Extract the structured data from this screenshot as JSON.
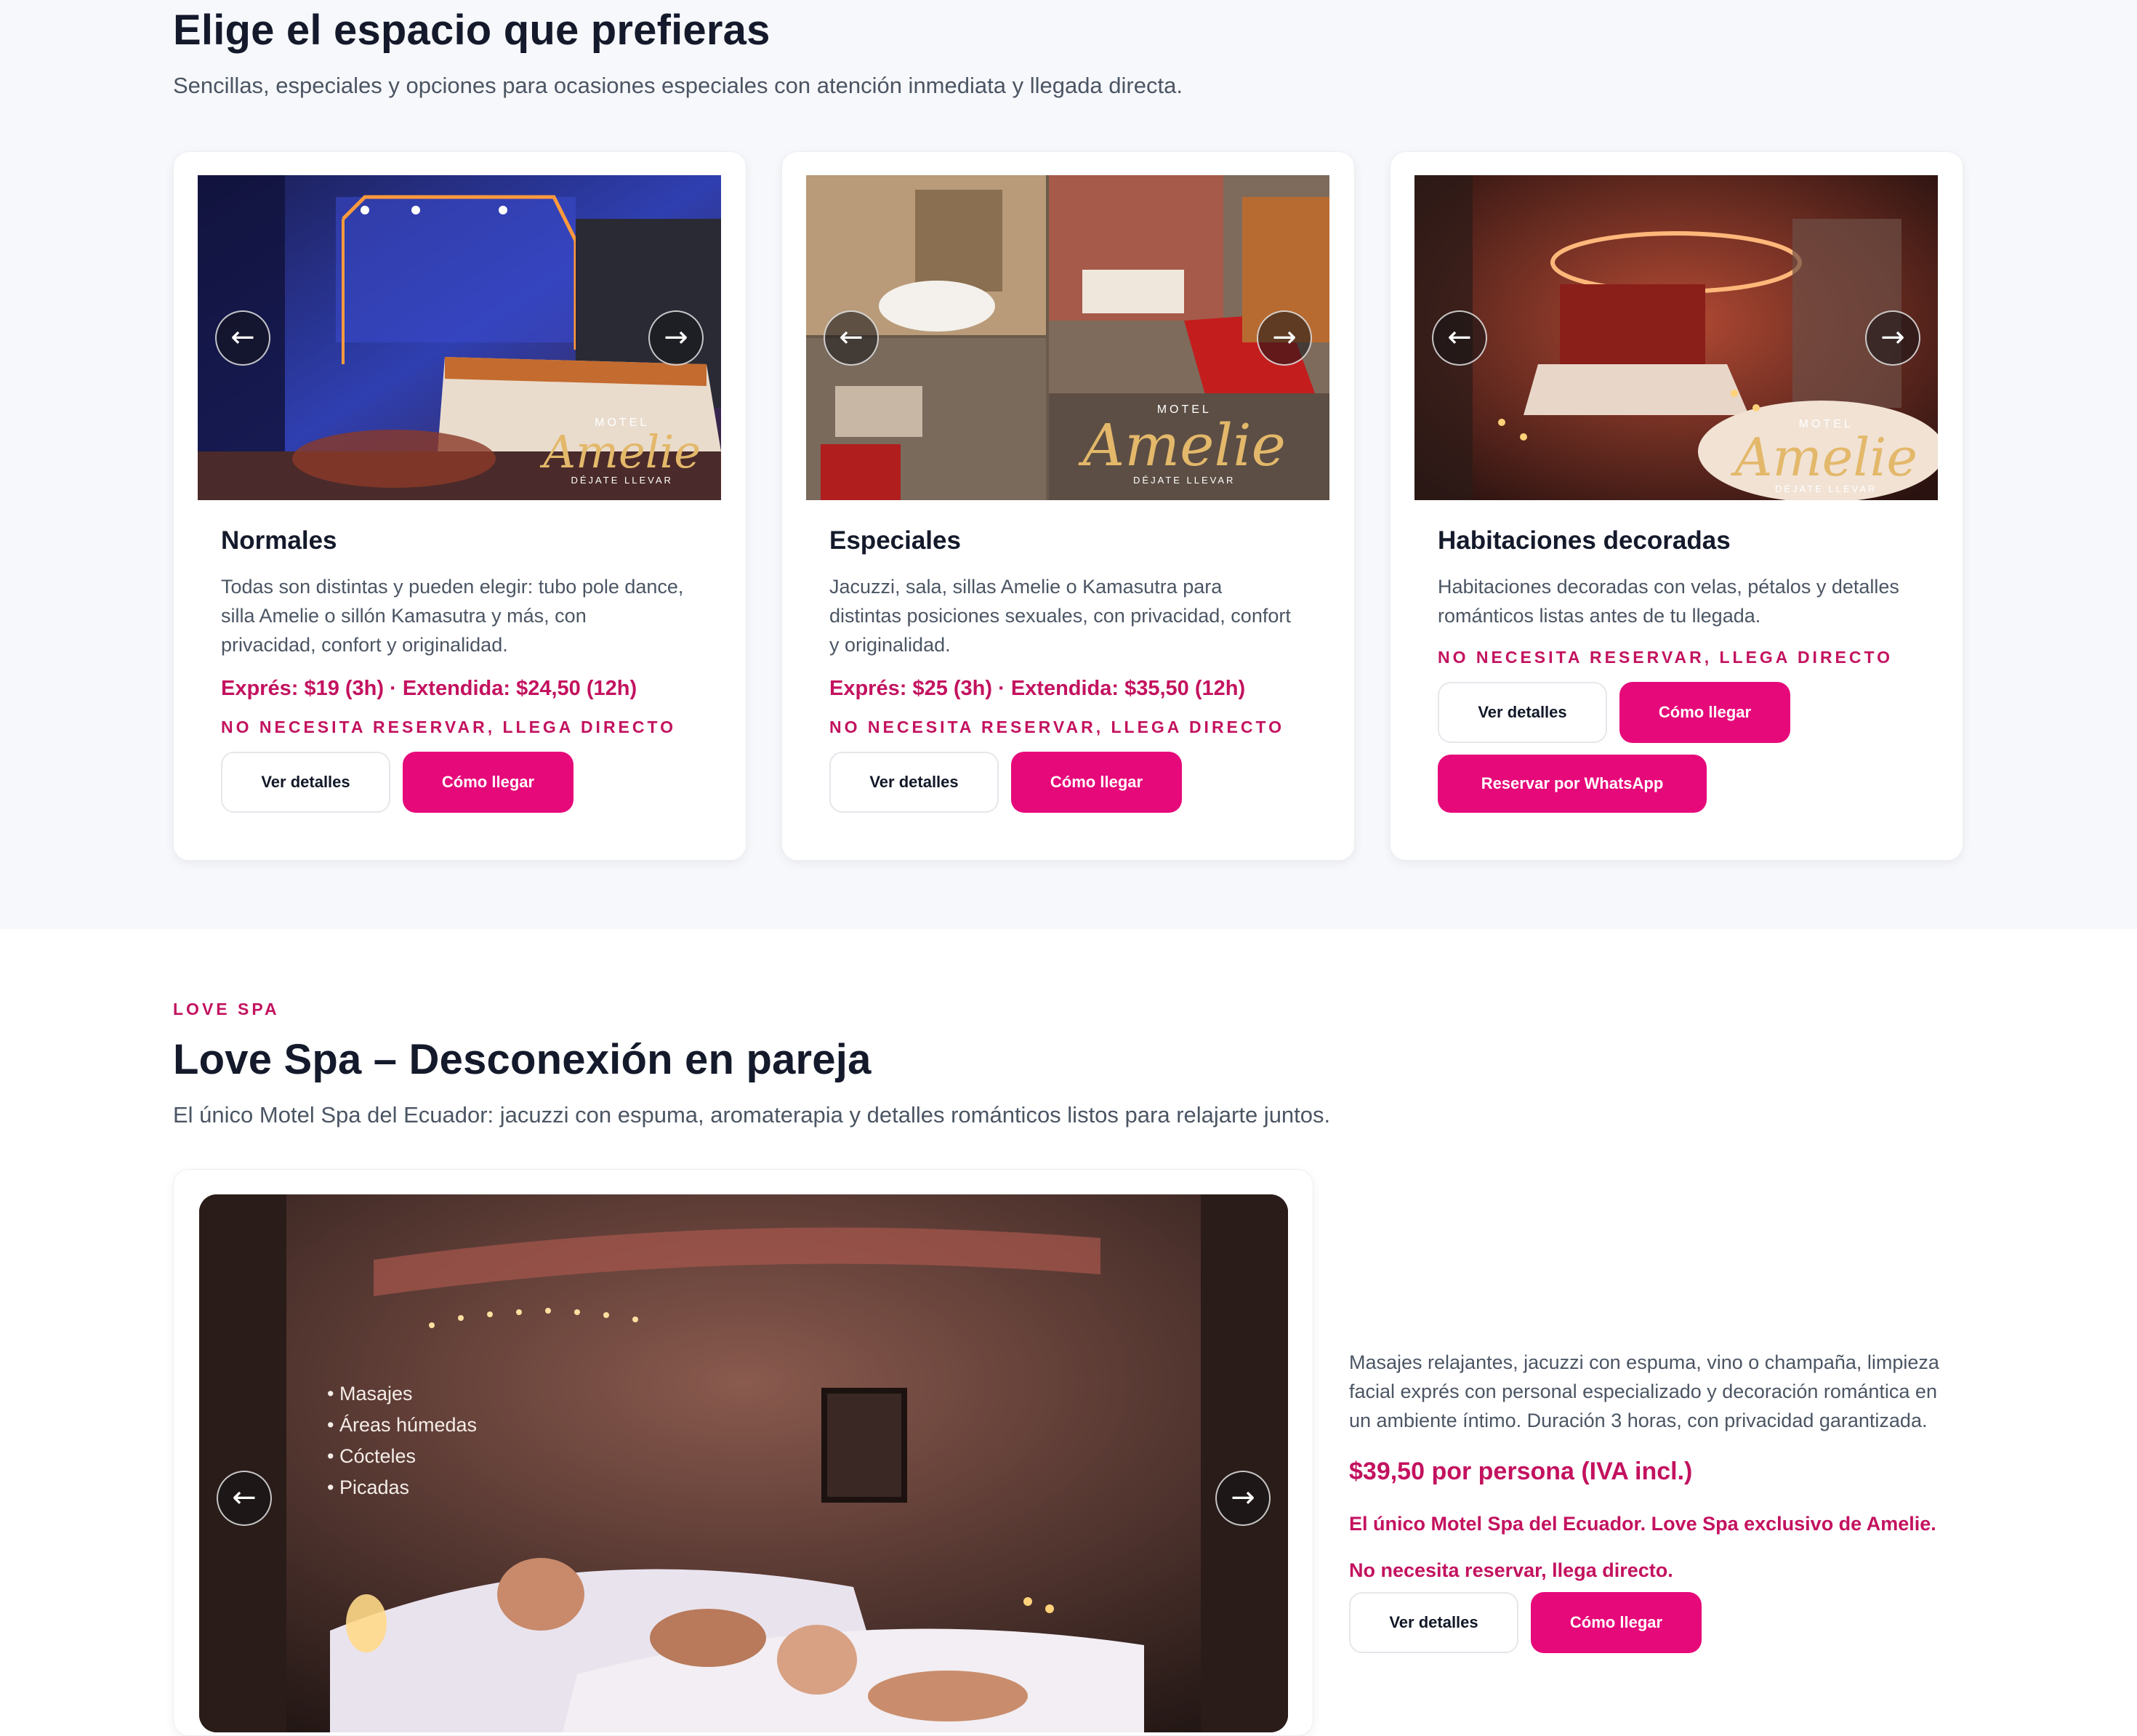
{
  "rooms_section": {
    "title": "Elige el espacio que prefieras",
    "subtitle": "Sencillas, especiales y opciones para ocasiones especiales con atención inmediata y llegada directa.",
    "cards": [
      {
        "title": "Normales",
        "description": "Todas son distintas y pueden elegir: tubo pole dance, silla Amelie o sillón Kamasutra y más, con privacidad, confort y originalidad.",
        "price": "Exprés: $19 (3h) · Extendida: $24,50 (12h)",
        "notice": "NO NECESITA RESERVAR, LLEGA DIRECTO",
        "details_label": "Ver detalles",
        "directions_label": "Cómo llegar"
      },
      {
        "title": "Especiales",
        "description": "Jacuzzi, sala, sillas Amelie o Kamasutra para distintas posiciones sexuales, con privacidad, confort y originalidad.",
        "price": "Exprés: $25 (3h) · Extendida: $35,50 (12h)",
        "notice": "NO NECESITA RESERVAR, LLEGA DIRECTO",
        "details_label": "Ver detalles",
        "directions_label": "Cómo llegar"
      },
      {
        "title": "Habitaciones decoradas",
        "description": "Habitaciones decoradas con velas, pétalos y detalles románticos listas antes de tu llegada.",
        "notice": "NO NECESITA RESERVAR, LLEGA DIRECTO",
        "details_label": "Ver detalles",
        "directions_label": "Cómo llegar",
        "whatsapp_label": "Reservar por WhatsApp"
      }
    ],
    "logo": {
      "top": "MOTEL",
      "name": "Amelie",
      "tagline": "DÉJATE LLEVAR"
    }
  },
  "spa_section": {
    "eyebrow": "LOVE SPA",
    "title": "Love Spa – Desconexión en pareja",
    "subtitle": "El único Motel Spa del Ecuador: jacuzzi con espuma, aromaterapia y detalles románticos listos para relajarte juntos.",
    "image_bullets": [
      "• Masajes",
      "• Áreas húmedas",
      "• Cócteles",
      "• Picadas"
    ],
    "description": "Masajes relajantes, jacuzzi con espuma, vino o champaña, limpieza facial exprés con personal especializado y decoración romántica en un ambiente íntimo. Duración 3 horas, con privacidad garantizada.",
    "price": "$39,50 por persona (IVA incl.)",
    "exclusive": "El único Motel Spa del Ecuador. Love Spa exclusivo de Amelie.",
    "notice": "No necesita reservar, llega directo.",
    "details_label": "Ver detalles",
    "directions_label": "Cómo llegar"
  },
  "carousel": {
    "prev_symbol": "←",
    "next_symbol": "→"
  },
  "colors": {
    "accent": "#e6097a",
    "accent_text": "#c3125f",
    "heading": "#141a2b",
    "muted": "#4b5563",
    "band": "#f7f8fb"
  }
}
